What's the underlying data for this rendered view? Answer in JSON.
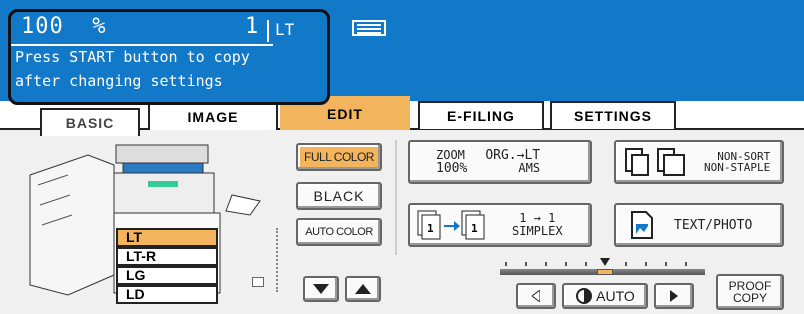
{
  "status": {
    "zoom_percent": "100  %",
    "copies": "1",
    "paper_size": "LT",
    "message_line1": "Press START button to copy",
    "message_line2": "after changing settings"
  },
  "tabs": {
    "basic": "BASIC",
    "image": "IMAGE",
    "edit": "EDIT",
    "efiling": "E-FILING",
    "settings": "SETTINGS"
  },
  "paper_trays": [
    "LT",
    "LT-R",
    "LG",
    "LD"
  ],
  "color_modes": {
    "full_color": "FULL COLOR",
    "black": "BLACK",
    "auto_color": "AUTO COLOR",
    "selected": "FULL COLOR"
  },
  "zoom_button": {
    "line1_left": "ZOOM",
    "line2_left": "100%",
    "line1_right": "ORG.→LT",
    "line2_right": "AMS"
  },
  "duplex_button": {
    "line1": "1 → 1",
    "line2": "SIMPLEX"
  },
  "finishing_button": {
    "line1": "NON-SORT",
    "line2": "NON-STAPLE"
  },
  "original_mode_button": {
    "label": "TEXT/PHOTO"
  },
  "density": {
    "auto_label": "AUTO",
    "proof_line1": "PROOF",
    "proof_line2": "COPY"
  },
  "colors": {
    "header_blue": "#1278c8",
    "selected_orange": "#f3b45e"
  }
}
